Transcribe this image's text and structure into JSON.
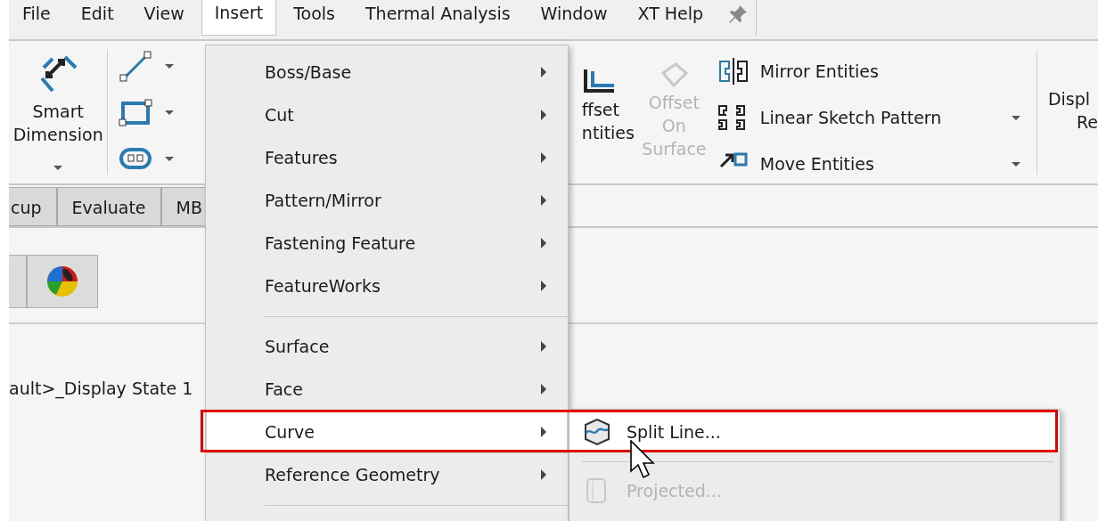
{
  "menu_bar": [
    {
      "label": "File",
      "selected": false
    },
    {
      "label": "Edit",
      "selected": false
    },
    {
      "label": "View",
      "selected": false
    },
    {
      "label": "Insert",
      "selected": true
    },
    {
      "label": "Tools",
      "selected": false
    },
    {
      "label": "Thermal Analysis",
      "selected": false
    },
    {
      "label": "Window",
      "selected": false
    },
    {
      "label": "XT Help",
      "selected": false
    }
  ],
  "ribbon": {
    "smart_dimension": {
      "lines": [
        "Smart",
        "Dimension"
      ]
    },
    "offset_entities": {
      "lines": [
        "ffset",
        "ntities"
      ],
      "disabled": false
    },
    "offset_on_surface": {
      "lines": [
        "Offset",
        "On",
        "Surface"
      ],
      "disabled": true
    },
    "small_buttons": [
      {
        "kind": "mirror",
        "label": "Mirror Entities",
        "has_dropdown": false
      },
      {
        "kind": "pattern",
        "label": "Linear Sketch Pattern",
        "has_dropdown": true
      },
      {
        "kind": "move",
        "label": "Move Entities",
        "has_dropdown": true
      }
    ],
    "cut_button": {
      "lines": [
        "Displ",
        "Re"
      ]
    }
  },
  "tabs": [
    {
      "label": "cup"
    },
    {
      "label": "Evaluate"
    },
    {
      "label": "MB"
    }
  ],
  "breadcrumb": "ault>_Display State 1",
  "insert_menu": [
    {
      "kind": "item",
      "label": "Boss/Base",
      "highlighted": false
    },
    {
      "kind": "item",
      "label": "Cut",
      "highlighted": false
    },
    {
      "kind": "item",
      "label": "Features",
      "highlighted": false
    },
    {
      "kind": "item",
      "label": "Pattern/Mirror",
      "highlighted": false
    },
    {
      "kind": "item",
      "label": "Fastening Feature",
      "highlighted": false
    },
    {
      "kind": "item",
      "label": "FeatureWorks",
      "highlighted": false
    },
    {
      "kind": "separator"
    },
    {
      "kind": "item",
      "label": "Surface",
      "highlighted": false
    },
    {
      "kind": "item",
      "label": "Face",
      "highlighted": false
    },
    {
      "kind": "item",
      "label": "Curve",
      "highlighted": true
    },
    {
      "kind": "item",
      "label": "Reference Geometry",
      "highlighted": false
    },
    {
      "kind": "separator"
    }
  ],
  "curve_submenu": [
    {
      "kind": "item",
      "label": "Split Line...",
      "highlighted": true,
      "disabled": false
    },
    {
      "kind": "separator"
    },
    {
      "kind": "item",
      "label": "Projected...",
      "highlighted": false,
      "disabled": true
    }
  ],
  "callout_frame": true
}
